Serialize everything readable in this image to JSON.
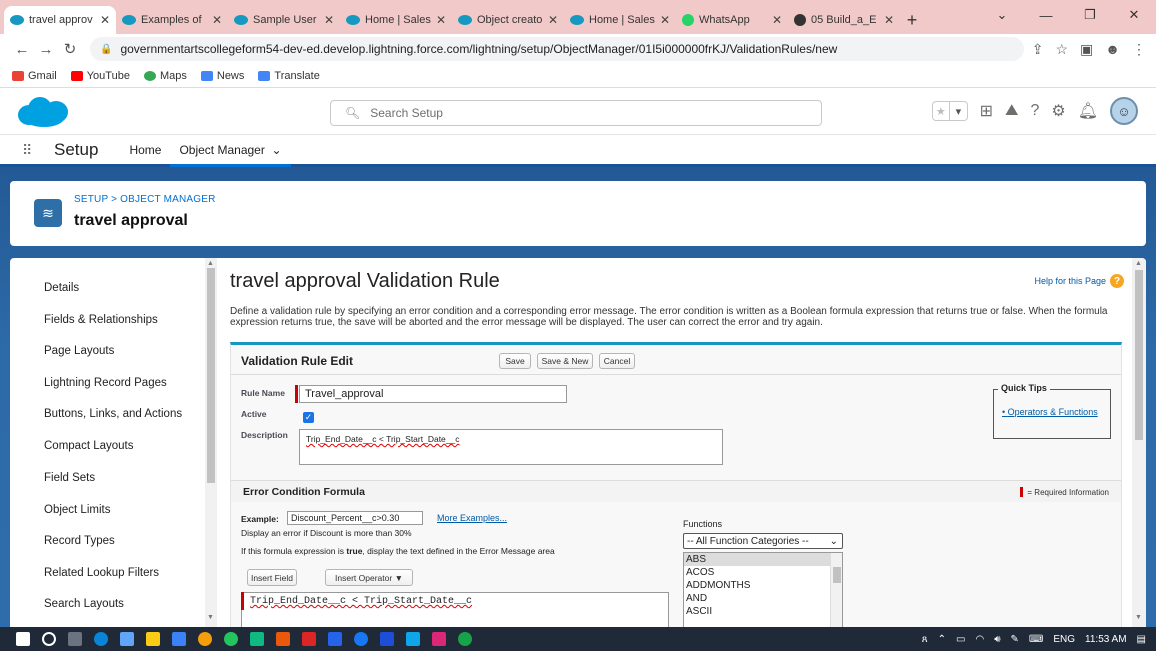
{
  "browser": {
    "tabs": [
      {
        "title": "travel approv",
        "active": true,
        "favicon": "salesforce"
      },
      {
        "title": "Examples of",
        "favicon": "salesforce"
      },
      {
        "title": "Sample User",
        "favicon": "salesforce"
      },
      {
        "title": "Home | Sales",
        "favicon": "salesforce"
      },
      {
        "title": "Object creato",
        "favicon": "salesforce"
      },
      {
        "title": "Home | Sales",
        "favicon": "salesforce"
      },
      {
        "title": "WhatsApp",
        "favicon": "whatsapp"
      },
      {
        "title": "05 Build_a_E",
        "favicon": "github"
      }
    ],
    "new_tab": "+",
    "url": "governmentartscollegeform54-dev-ed.develop.lightning.force.com/lightning/setup/ObjectManager/01I5i000000frKJ/ValidationRules/new",
    "bookmarks": [
      "Gmail",
      "YouTube",
      "Maps",
      "News",
      "Translate"
    ]
  },
  "sf": {
    "search_placeholder": "Search Setup",
    "nav_title": "Setup",
    "nav_items": [
      "Home",
      "Object Manager"
    ],
    "breadcrumb": "SETUP > OBJECT MANAGER",
    "object_title": "travel approval"
  },
  "sidebar": {
    "items": [
      "Details",
      "Fields & Relationships",
      "Page Layouts",
      "Lightning Record Pages",
      "Buttons, Links, and Actions",
      "Compact Layouts",
      "Field Sets",
      "Object Limits",
      "Record Types",
      "Related Lookup Filters",
      "Search Layouts"
    ]
  },
  "page": {
    "title": "travel approval Validation Rule",
    "help": "Help for this Page",
    "description": "Define a validation rule by specifying an error condition and a corresponding error message. The error condition is written as a Boolean formula expression that returns true or false. When the formula expression returns true, the save will be aborted and the error message will be displayed. The user can correct the error and try again."
  },
  "edit": {
    "title": "Validation Rule Edit",
    "save": "Save",
    "save_new": "Save & New",
    "cancel": "Cancel",
    "rule_name_label": "Rule Name",
    "rule_name": "Travel_approval",
    "active_label": "Active",
    "active": true,
    "description_label": "Description",
    "description": "Trip_End_Date__c < Trip_Start_Date__c",
    "quick_tips": "Quick Tips",
    "quick_tips_link": "Operators & Functions"
  },
  "formula": {
    "section_title": "Error Condition Formula",
    "required_info": "= Required Information",
    "example_label": "Example:",
    "example_value": "Discount_Percent__c>0.30",
    "more_examples": "More Examples...",
    "example_desc": "Display an error if Discount is more than 30%",
    "hint_pre": "If this formula expression is",
    "hint_bold": "true",
    "hint_post": ", display the text defined in the Error Message area",
    "insert_field": "Insert Field",
    "insert_operator": "Insert Operator",
    "functions_label": "Functions",
    "functions_category": "-- All Function Categories --",
    "functions": [
      "ABS",
      "ACOS",
      "ADDMONTHS",
      "AND",
      "ASCII"
    ],
    "formula_text": "Trip_End_Date__c < Trip_Start_Date__c"
  },
  "taskbar": {
    "lang": "ENG",
    "time": "11:53 AM"
  },
  "colors": {
    "salesforce_blue": "#00a1e0",
    "brand_band": "#2d6aa8",
    "link": "#015ba7",
    "required": "#cc0000"
  }
}
